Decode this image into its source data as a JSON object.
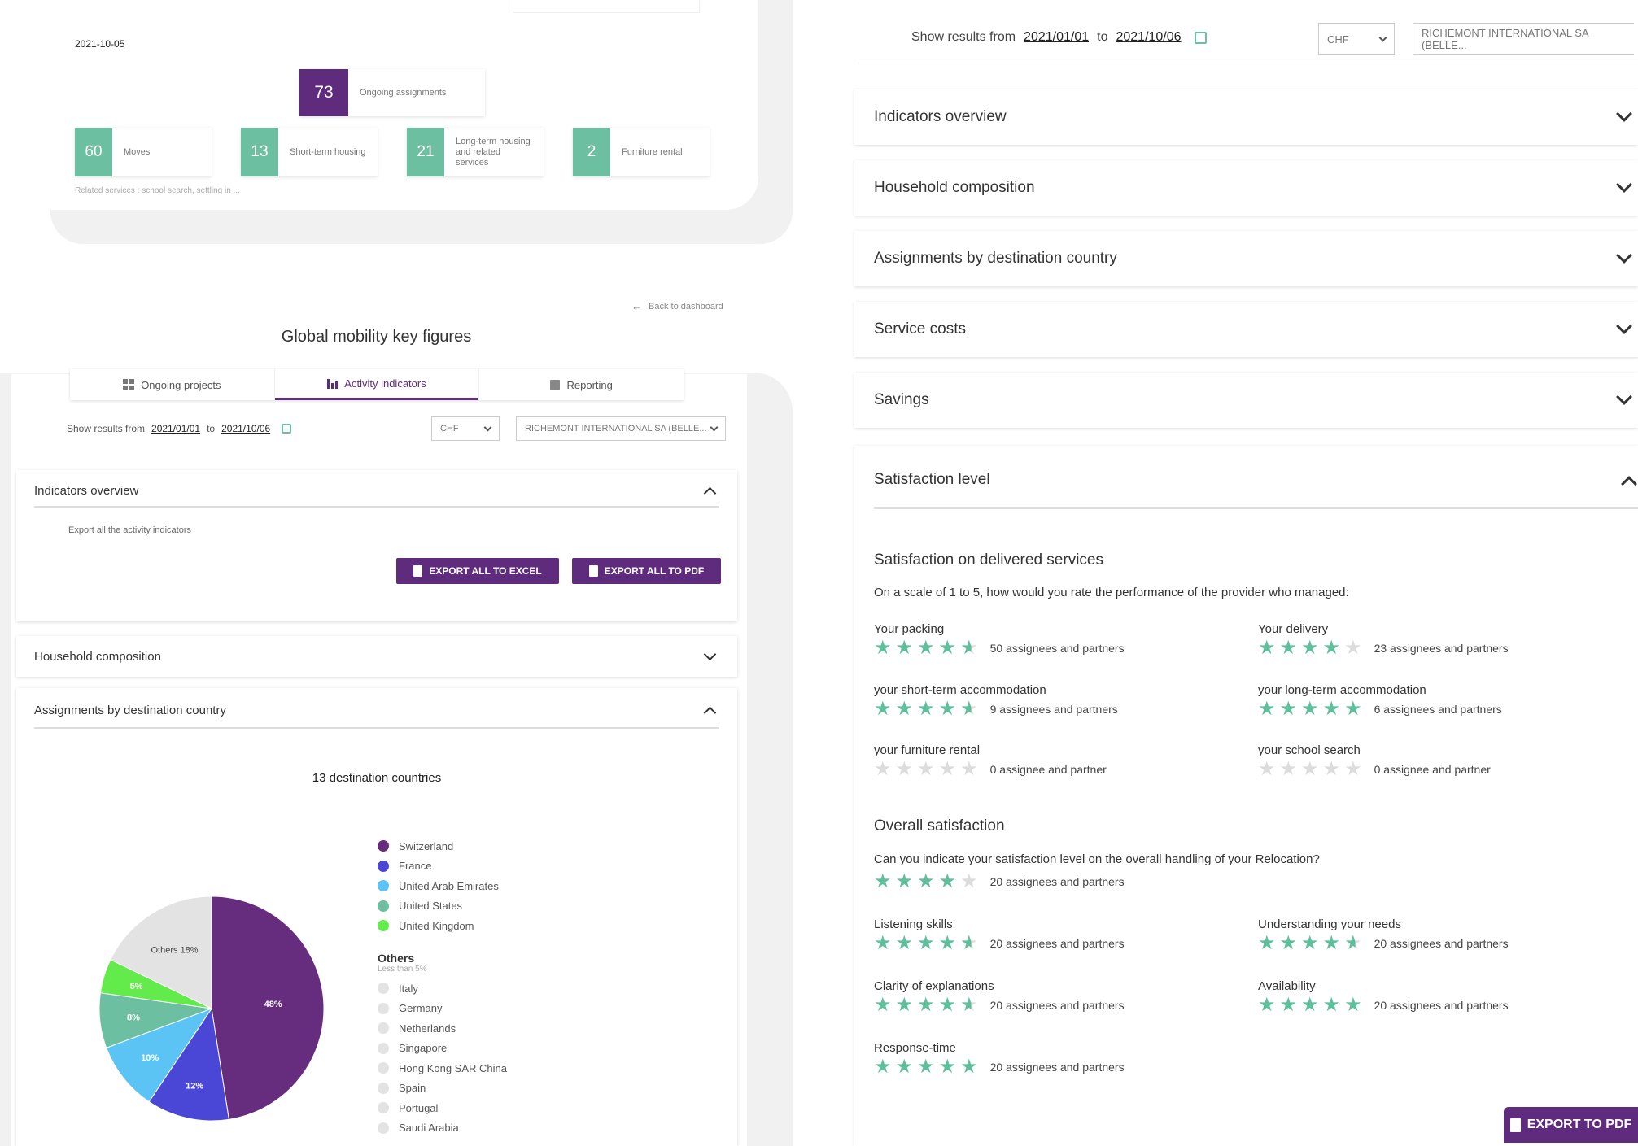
{
  "left": {
    "date": "2021-10-05",
    "top_stat": {
      "value": "73",
      "label": "Ongoing assignments"
    },
    "stats": [
      {
        "value": "60",
        "label": "Moves"
      },
      {
        "value": "13",
        "label": "Short-term housing"
      },
      {
        "value": "21",
        "label": "Long-term housing and related services"
      },
      {
        "value": "2",
        "label": "Furniture rental"
      }
    ],
    "related": "Related services : school search, settling in ...",
    "back": "Back to dashboard",
    "page_title": "Global mobility key figures",
    "tabs": [
      {
        "label": "Ongoing projects"
      },
      {
        "label": "Activity indicators"
      },
      {
        "label": "Reporting"
      }
    ],
    "filter": {
      "prefix": "Show results from",
      "from": "2021/01/01",
      "to_word": "to",
      "to": "2021/10/06",
      "currency": "CHF",
      "company": "RICHEMONT INTERNATIONAL SA (BELLE..."
    },
    "indicators": {
      "title": "Indicators overview",
      "desc": "Export all the activity indicators",
      "excel": "EXPORT ALL TO EXCEL",
      "pdf": "EXPORT ALL TO PDF"
    },
    "household": "Household composition",
    "assignments": {
      "title": "Assignments by destination country",
      "subtitle": "13 destination countries"
    },
    "others_title": "Others",
    "others_sub": "Less than 5%",
    "others": [
      "Italy",
      "Germany",
      "Netherlands",
      "Singapore",
      "Hong Kong SAR China",
      "Spain",
      "Portugal",
      "Saudi Arabia"
    ]
  },
  "chart_data": {
    "type": "pie",
    "title": "13 destination countries",
    "series": [
      {
        "values": [
          {
            "name": "Switzerland",
            "value": 48,
            "label": "48%",
            "color": "#662d7e"
          },
          {
            "name": "France",
            "value": 12,
            "label": "12%",
            "color": "#4a47d6"
          },
          {
            "name": "United Arab Emirates",
            "value": 10,
            "label": "10%",
            "color": "#5cc4f5"
          },
          {
            "name": "United States",
            "value": 8,
            "label": "8%",
            "color": "#6cbfa0"
          },
          {
            "name": "United Kingdom",
            "value": 5,
            "label": "5%",
            "color": "#63ea4b"
          },
          {
            "name": "Others",
            "value": 18,
            "label": "Others 18%",
            "color": "#e3e3e3"
          }
        ]
      }
    ],
    "legend": "right"
  },
  "right": {
    "filter": {
      "prefix": "Show results from",
      "from": "2021/01/01",
      "to_word": "to",
      "to": "2021/10/06",
      "currency": "CHF",
      "company": "RICHEMONT INTERNATIONAL SA (BELLE..."
    },
    "sections": [
      "Indicators overview",
      "Household composition",
      "Assignments by destination country",
      "Service costs",
      "Savings"
    ],
    "satisfaction": "Satisfaction level",
    "delivered_title": "Satisfaction on delivered services",
    "delivered_question": "On a scale of 1 to 5, how would you rate the performance of the provider who managed:",
    "overall_title": "Overall satisfaction",
    "overall_question": "Can you indicate your satisfaction level on the overall handling of your Relocation?",
    "overall_count": "20 assignees and partners",
    "overall_rating": 4,
    "ratings": [
      {
        "label": "Your packing",
        "rating": 4.5,
        "count": "50 assignees and partners"
      },
      {
        "label": "Your delivery",
        "rating": 4,
        "count": "23 assignees and partners"
      },
      {
        "label": "your short-term accommodation",
        "rating": 4.5,
        "count": "9 assignees and partners"
      },
      {
        "label": "your long-term accommodation",
        "rating": 5,
        "count": "6 assignees and partners"
      },
      {
        "label": "your furniture rental",
        "rating": 0,
        "count": "0 assignee and partner"
      },
      {
        "label": "your school search",
        "rating": 0,
        "count": "0 assignee and partner"
      },
      {
        "label": "Listening skills",
        "rating": 4.5,
        "count": "20 assignees and partners"
      },
      {
        "label": "Understanding your needs",
        "rating": 4.5,
        "count": "20 assignees and partners"
      },
      {
        "label": "Clarity of explanations",
        "rating": 4.5,
        "count": "20 assignees and partners"
      },
      {
        "label": "Availability",
        "rating": 5,
        "count": "20 assignees and partners"
      },
      {
        "label": "Response-time",
        "rating": 5,
        "count": "20 assignees and partners"
      }
    ],
    "export_pdf": "EXPORT TO PDF",
    "colors": {
      "accent": "#5f2b7c",
      "star": "#5fbf9b",
      "star_empty": "#dcdcdc"
    }
  }
}
